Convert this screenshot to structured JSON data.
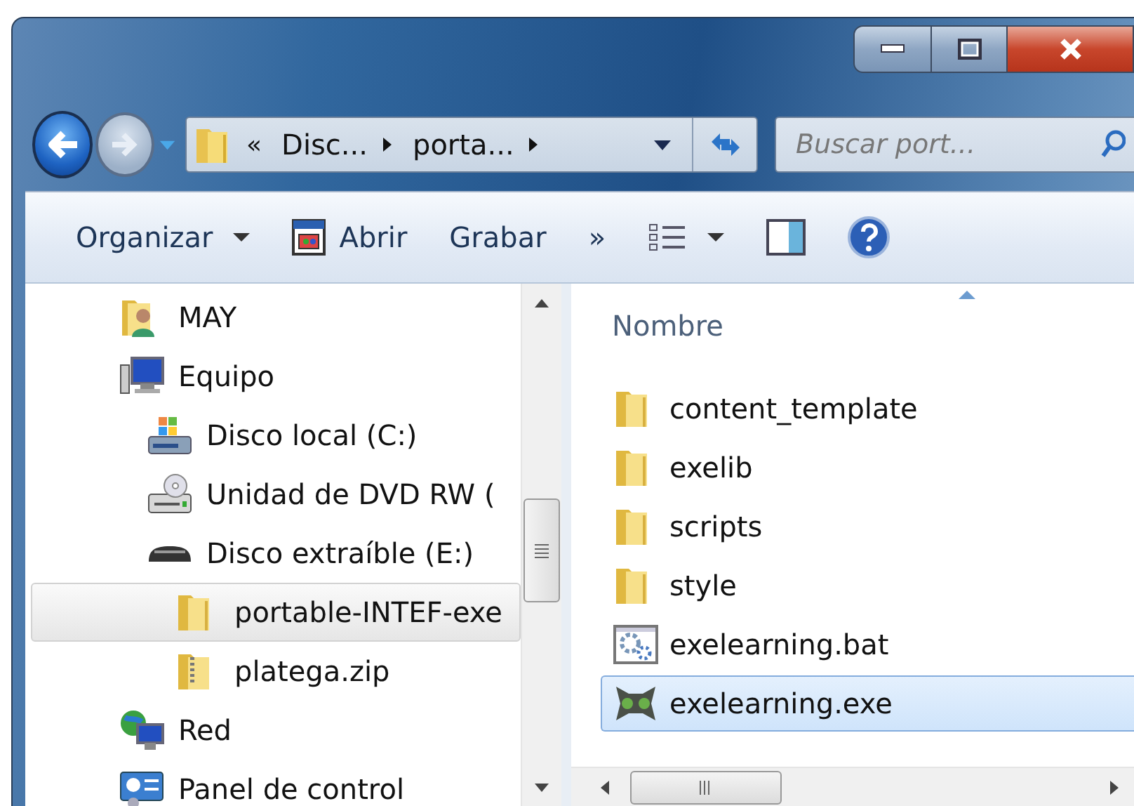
{
  "window": {
    "controls": [
      {
        "kind": "minimize"
      },
      {
        "kind": "maximize"
      },
      {
        "kind": "close"
      }
    ]
  },
  "address_bar": {
    "overflow": "«",
    "breadcrumbs": [
      "Disc...",
      "porta..."
    ]
  },
  "search": {
    "placeholder": "Buscar port..."
  },
  "toolbar": [
    {
      "kind": "menu",
      "label": "Organizar"
    },
    {
      "kind": "open",
      "label": "Abrir"
    },
    {
      "kind": "text",
      "label": "Grabar"
    },
    {
      "kind": "text",
      "label": "»"
    },
    {
      "kind": "views"
    },
    {
      "kind": "pane"
    },
    {
      "kind": "help"
    }
  ],
  "nav_tree": [
    {
      "kind": "user-folder",
      "label": "MAY",
      "selected": false
    },
    {
      "kind": "computer",
      "label": "Equipo",
      "selected": false,
      "children": [
        {
          "kind": "windows-drive",
          "label": "Disco local (C:)",
          "selected": false
        },
        {
          "kind": "dvd-drive",
          "label": "Unidad de DVD RW (",
          "selected": false
        },
        {
          "kind": "removable-drive",
          "label": "Disco extraíble (E:)",
          "selected": false,
          "children": [
            {
              "kind": "folder",
              "label": "portable-INTEF-exe",
              "selected": true
            },
            {
              "kind": "zip",
              "label": "platega.zip",
              "selected": false
            }
          ]
        }
      ]
    },
    {
      "kind": "network",
      "label": "Red",
      "selected": false
    },
    {
      "kind": "control-panel",
      "label": "Panel de control",
      "selected": false
    }
  ],
  "file_list": {
    "column": "Nombre",
    "sorted": true,
    "items": [
      {
        "kind": "folder",
        "name": "content_template",
        "selected": false
      },
      {
        "kind": "folder",
        "name": "exelib",
        "selected": false
      },
      {
        "kind": "folder",
        "name": "scripts",
        "selected": false
      },
      {
        "kind": "folder",
        "name": "style",
        "selected": false
      },
      {
        "kind": "batch",
        "name": "exelearning.bat",
        "selected": false
      },
      {
        "kind": "app",
        "name": "exelearning.exe",
        "selected": true
      }
    ]
  }
}
